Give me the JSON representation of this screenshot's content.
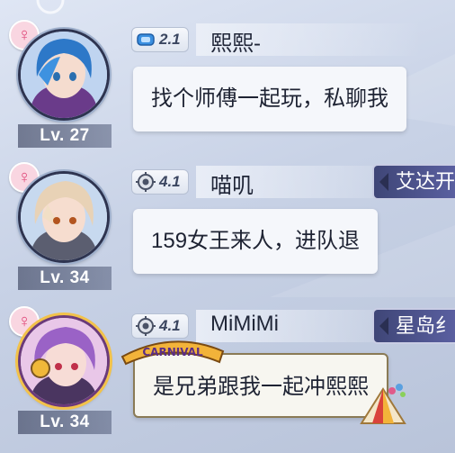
{
  "messages": [
    {
      "gender_symbol": "♀",
      "level": "Lv. 27",
      "vip_level": "2.1",
      "name": "熙熙-",
      "text": "找个师傅一起玩，私聊我",
      "guild": ""
    },
    {
      "gender_symbol": "♀",
      "level": "Lv. 34",
      "vip_level": "4.1",
      "name": "喵叽",
      "text": "159女王来人，进队退",
      "guild": "艾达开"
    },
    {
      "gender_symbol": "♀",
      "level": "Lv. 34",
      "vip_level": "4.1",
      "name": "MiMiMi",
      "text": "是兄弟跟我一起冲熙熙",
      "guild": "星岛纟",
      "bubble_frame_label": "CARNIVAL"
    }
  ],
  "icons": {
    "gender": "female-icon",
    "vip": "vip-badge-icon"
  },
  "colors": {
    "female_pink": "#e0497a",
    "guild_purple": "#4a4f88"
  }
}
